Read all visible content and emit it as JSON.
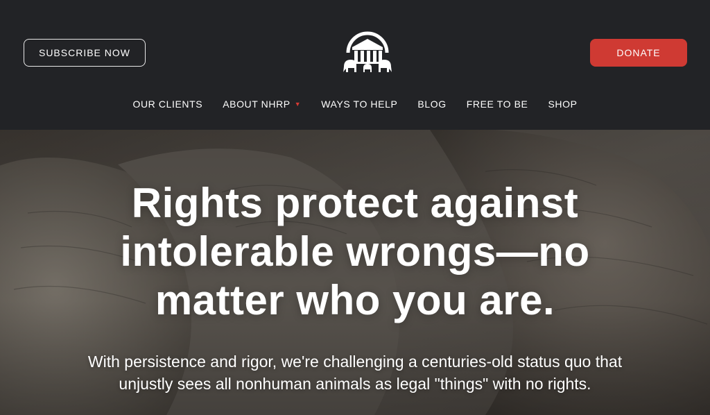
{
  "header": {
    "subscribe_label": "SUBSCRIBE NOW",
    "donate_label": "DONATE",
    "logo_icon": "courthouse-elephants-logo-icon"
  },
  "nav": {
    "items": [
      {
        "label": "OUR CLIENTS"
      },
      {
        "label": "ABOUT NHRP",
        "has_dropdown": true
      },
      {
        "label": "WAYS TO HELP"
      },
      {
        "label": "BLOG"
      },
      {
        "label": "FREE TO BE"
      },
      {
        "label": "SHOP"
      }
    ],
    "dropdown_icon": "caret-down-icon"
  },
  "hero": {
    "headline_line1": "Rights protect against",
    "headline_line2": "intolerable wrongs—no",
    "headline_line3": "matter who you are.",
    "subtext_line1": "With persistence and rigor, we're challenging a centuries-old status quo that",
    "subtext_line2": "unjustly sees all nonhuman animals as legal \"things\" with no rights.",
    "background_image": "elephants-photo"
  },
  "colors": {
    "header_bg": "#222326",
    "donate_bg": "#cf3a33",
    "caret": "#d63a33",
    "text": "#ffffff"
  }
}
